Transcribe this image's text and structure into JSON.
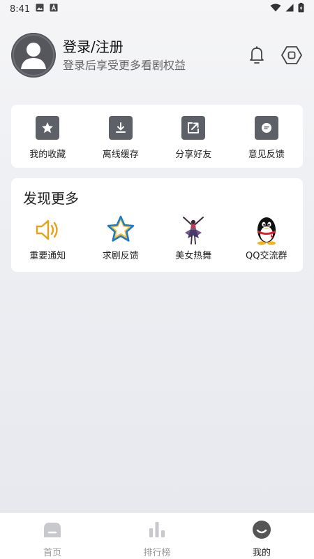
{
  "status_bar": {
    "time": "8:41"
  },
  "profile": {
    "title": "登录/注册",
    "subtitle": "登录后享受更多看剧权益",
    "avatar_icon": "user-avatar-icon",
    "bell_icon": "bell-icon",
    "settings_icon": "hexagon-settings-icon"
  },
  "tools": {
    "items": [
      {
        "label": "我的收藏",
        "icon": "star-icon"
      },
      {
        "label": "离线缓存",
        "icon": "download-icon"
      },
      {
        "label": "分享好友",
        "icon": "share-icon"
      },
      {
        "label": "意见反馈",
        "icon": "feedback-icon"
      }
    ]
  },
  "discover": {
    "title": "发现更多",
    "items": [
      {
        "label": "重要通知",
        "icon": "speaker-icon"
      },
      {
        "label": "求剧反馈",
        "icon": "star-outline-icon"
      },
      {
        "label": "美女热舞",
        "icon": "dancer-icon"
      },
      {
        "label": "QQ交流群",
        "icon": "qq-penguin-icon"
      }
    ]
  },
  "bottom_nav": {
    "items": [
      {
        "label": "首页",
        "icon": "home-icon",
        "active": false
      },
      {
        "label": "排行榜",
        "icon": "ranking-icon",
        "active": false
      },
      {
        "label": "我的",
        "icon": "profile-icon",
        "active": true
      }
    ]
  },
  "colors": {
    "accent_gold": "#e8a21a",
    "icon_gray": "#5d6167",
    "nav_inactive": "#999999"
  }
}
